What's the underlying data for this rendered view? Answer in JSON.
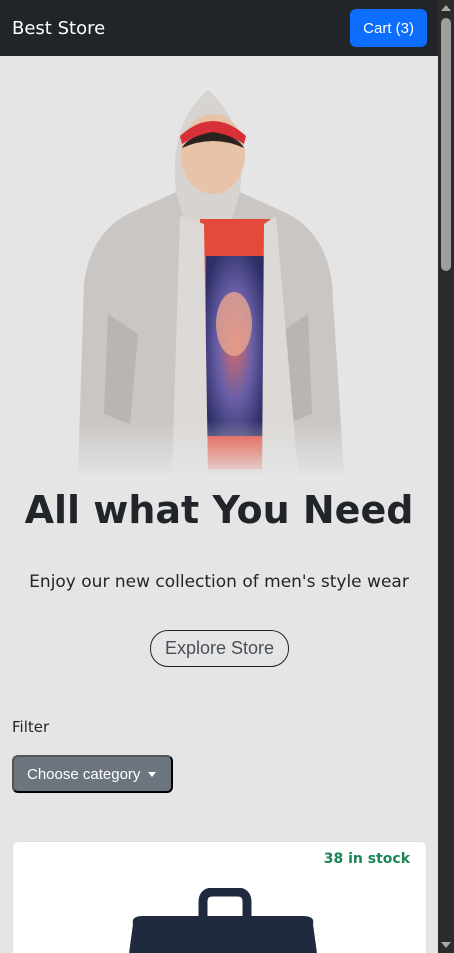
{
  "navbar": {
    "brand": "Best Store",
    "cart_label": "Cart (3)"
  },
  "hero": {
    "title": "All what You Need",
    "subtitle": "Enjoy our new collection of men's style wear",
    "cta_label": "Explore Store"
  },
  "filter": {
    "label": "Filter",
    "category_button_label": "Choose category"
  },
  "product": {
    "stock_label": "38 in stock"
  },
  "colors": {
    "navbar": "#212529",
    "primary": "#0d6efd",
    "secondary": "#6c757d",
    "success": "#198754"
  }
}
